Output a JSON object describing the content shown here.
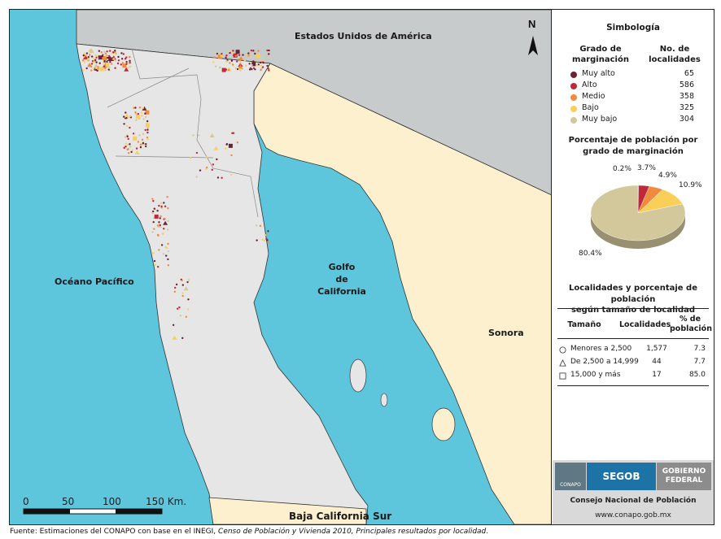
{
  "map": {
    "labels": {
      "usa": "Estados Unidos de América",
      "pacific": "Océano Pacífico",
      "gulf_line1": "Golfo",
      "gulf_line2": "de",
      "gulf_line3": "California",
      "sonora": "Sonora",
      "bcs": "Baja California Sur"
    },
    "north_arrow": "N",
    "scale": {
      "ticks": [
        "0",
        "50",
        "100",
        "150 Km."
      ]
    },
    "colors": {
      "sea": "#5ec6dc",
      "land_bc": "#e6e6e6",
      "land_other": "#fdf0cf",
      "usa": "#c7cbcc"
    }
  },
  "legend": {
    "title": "Simbología",
    "col1_line1": "Grado de",
    "col1_line2": "marginación",
    "col2_line1": "No. de",
    "col2_line2": "localidades",
    "items": [
      {
        "label": "Muy alto",
        "count": "65",
        "color": "#6b2232"
      },
      {
        "label": "Alto",
        "count": "586",
        "color": "#c0283a"
      },
      {
        "label": "Medio",
        "count": "358",
        "color": "#f08a3c"
      },
      {
        "label": "Bajo",
        "count": "325",
        "color": "#f9cf57"
      },
      {
        "label": "Muy bajo",
        "count": "304",
        "color": "#d3c89c"
      }
    ]
  },
  "pie": {
    "title_line1": "Porcentaje de población por",
    "title_line2": "grado de marginación",
    "slices": [
      {
        "label": "0.2%",
        "value": 0.2,
        "color": "#6b2232"
      },
      {
        "label": "3.7%",
        "value": 3.7,
        "color": "#c0283a"
      },
      {
        "label": "4.9%",
        "value": 4.9,
        "color": "#f08a3c"
      },
      {
        "label": "10.9%",
        "value": 10.9,
        "color": "#f9cf57"
      },
      {
        "label": "80.4%",
        "value": 80.4,
        "color": "#d3c89c"
      }
    ]
  },
  "table": {
    "title_line1": "Localidades y porcentaje de población",
    "title_line2": "según tamaño de localidad",
    "headers": {
      "size": "Tamaño",
      "loc": "Localidades",
      "pct_line1": "% de",
      "pct_line2": "población"
    },
    "rows": [
      {
        "symbol": "circle",
        "size": "Menores a 2,500",
        "loc": "1,577",
        "pct": "7.3"
      },
      {
        "symbol": "triangle",
        "size": "De 2,500 a 14,999",
        "loc": "44",
        "pct": "7.7"
      },
      {
        "symbol": "square",
        "size": "15,000 y más",
        "loc": "17",
        "pct": "85.0"
      }
    ]
  },
  "logos": {
    "conapo": "CONAPO",
    "segob": "SEGOB",
    "gobierno_line1": "GOBIERNO",
    "gobierno_line2": "FEDERAL",
    "consejo": "Consejo Nacional de Población",
    "url": "www.conapo.gob.mx"
  },
  "footer": {
    "prefix": "Fuente: Estimaciones del CONAPO con base en el INEGI, ",
    "italic": "Censo de Población y Vivienda 2010, Principales resultados por localidad",
    "suffix": "."
  }
}
